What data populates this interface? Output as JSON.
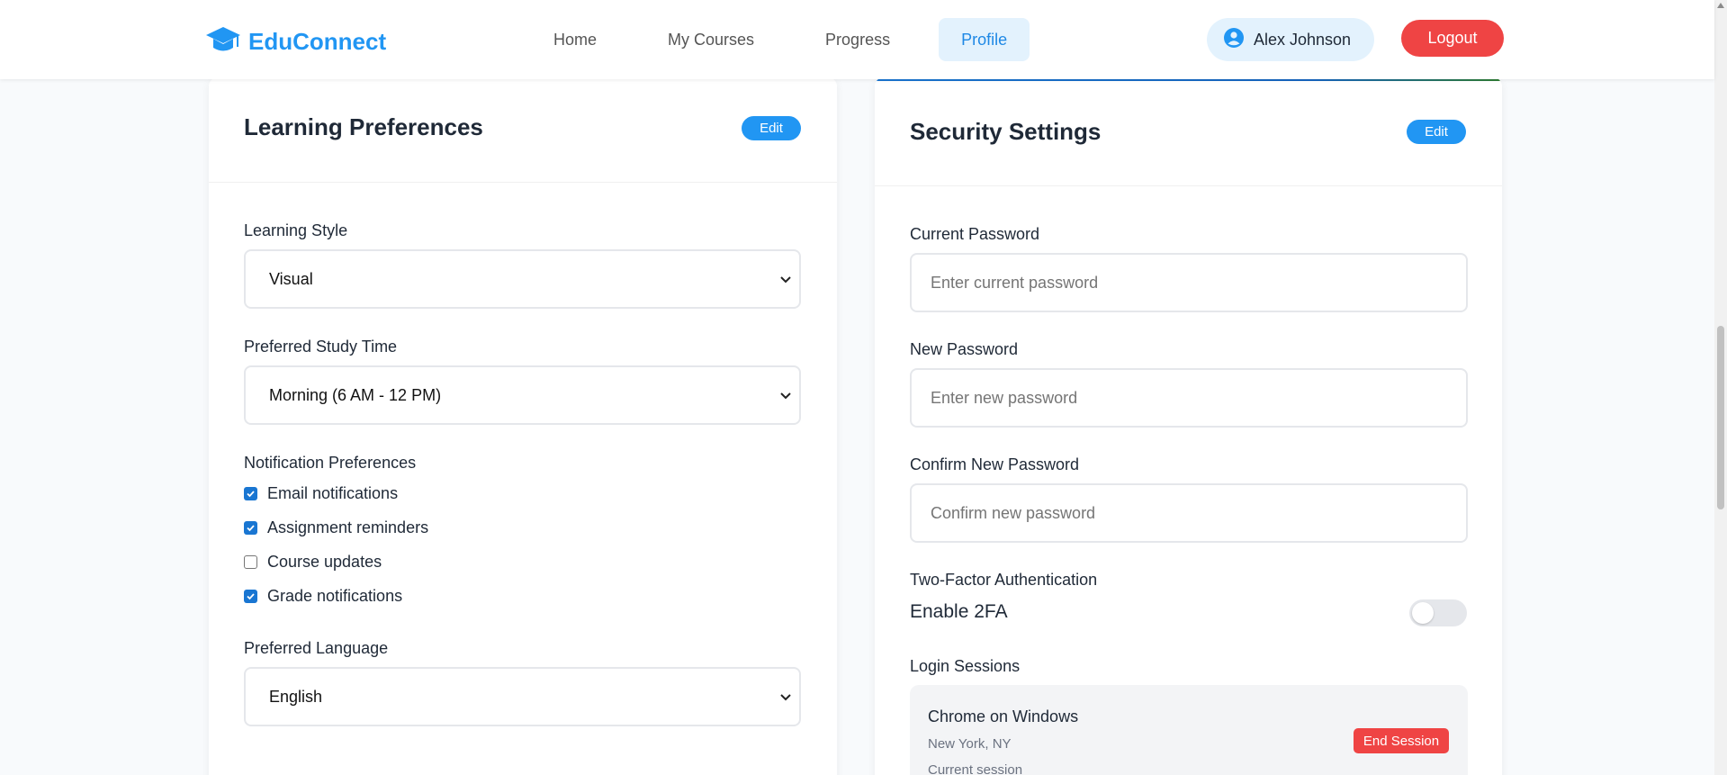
{
  "header": {
    "brand": "EduConnect",
    "nav": [
      {
        "label": "Home",
        "active": false
      },
      {
        "label": "My Courses",
        "active": false
      },
      {
        "label": "Progress",
        "active": false
      },
      {
        "label": "Profile",
        "active": true
      }
    ],
    "user_name": "Alex Johnson",
    "logout_label": "Logout"
  },
  "learning": {
    "title": "Learning Preferences",
    "edit_label": "Edit",
    "style_label": "Learning Style",
    "style_value": "Visual",
    "time_label": "Preferred Study Time",
    "time_value": "Morning (6 AM - 12 PM)",
    "notif_label": "Notification Preferences",
    "notifications": [
      {
        "label": "Email notifications",
        "checked": true
      },
      {
        "label": "Assignment reminders",
        "checked": true
      },
      {
        "label": "Course updates",
        "checked": false
      },
      {
        "label": "Grade notifications",
        "checked": true
      }
    ],
    "lang_label": "Preferred Language",
    "lang_value": "English"
  },
  "security": {
    "title": "Security Settings",
    "edit_label": "Edit",
    "current_label": "Current Password",
    "current_placeholder": "Enter current password",
    "new_label": "New Password",
    "new_placeholder": "Enter new password",
    "confirm_label": "Confirm New Password",
    "confirm_placeholder": "Confirm new password",
    "tfa_label": "Two-Factor Authentication",
    "tfa_text": "Enable 2FA",
    "tfa_enabled": false,
    "sessions_label": "Login Sessions",
    "session": {
      "name": "Chrome on Windows",
      "location": "New York, NY",
      "status": "Current session",
      "end_label": "End Session"
    }
  },
  "colors": {
    "brand": "#2196f3",
    "danger": "#ef4444",
    "active_nav_bg": "#e3f2fd"
  }
}
